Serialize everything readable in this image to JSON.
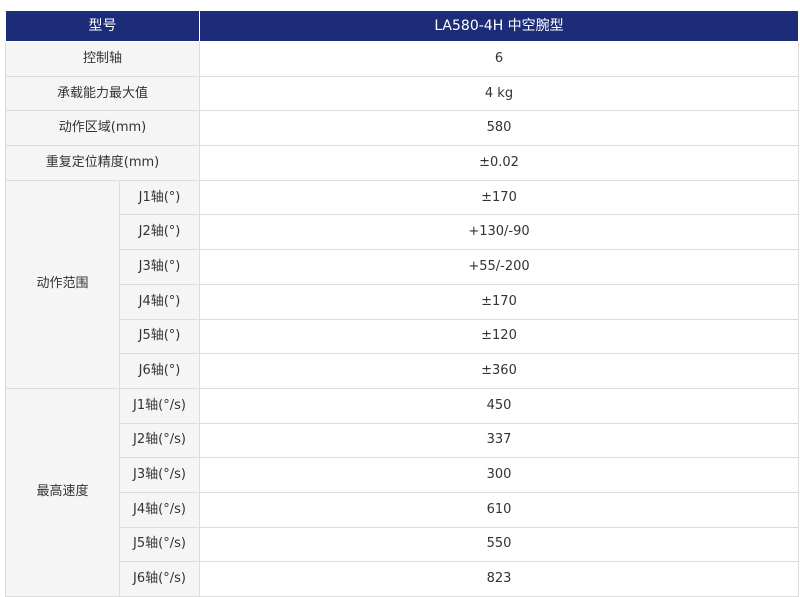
{
  "header": {
    "col1": "型号",
    "col2": "LA580-4H 中空腕型"
  },
  "rows": [
    {
      "label": "控制轴",
      "value": "6"
    },
    {
      "label": "承载能力最大值",
      "value": "4 kg"
    },
    {
      "label": "动作区域(mm)",
      "value": "580"
    },
    {
      "label": "重复定位精度(mm)",
      "value": "±0.02"
    }
  ],
  "motion_range": {
    "label": "动作范围",
    "items": [
      {
        "axis": "J1轴(°)",
        "value": "±170"
      },
      {
        "axis": "J2轴(°)",
        "value": "+130/-90"
      },
      {
        "axis": "J3轴(°)",
        "value": "+55/-200"
      },
      {
        "axis": "J4轴(°)",
        "value": "±170"
      },
      {
        "axis": "J5轴(°)",
        "value": "±120"
      },
      {
        "axis": "J6轴(°)",
        "value": "±360"
      }
    ]
  },
  "max_speed": {
    "label": "最高速度",
    "items": [
      {
        "axis": "J1轴(°/s)",
        "value": "450"
      },
      {
        "axis": "J2轴(°/s)",
        "value": "337"
      },
      {
        "axis": "J3轴(°/s)",
        "value": "300"
      },
      {
        "axis": "J4轴(°/s)",
        "value": "610"
      },
      {
        "axis": "J5轴(°/s)",
        "value": "550"
      },
      {
        "axis": "J6轴(°/s)",
        "value": "823"
      }
    ]
  }
}
